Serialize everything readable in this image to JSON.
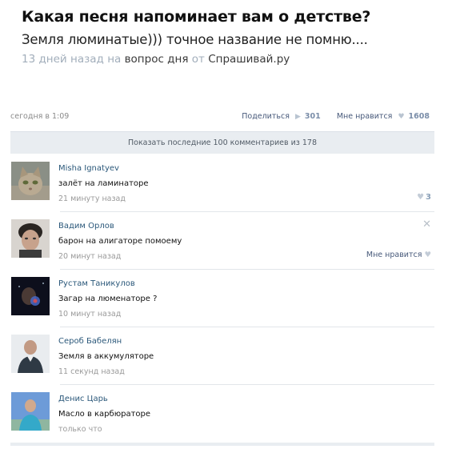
{
  "question": {
    "title": "Какая песня напоминает вам о детстве?",
    "body": "Земля люминатые))) точное название не помню....",
    "meta_time": "13 дней назад",
    "meta_on": "на",
    "meta_section": "вопрос дня",
    "meta_from": "от",
    "meta_source": "Спрашивай.ру"
  },
  "post_bar": {
    "date": "сегодня в 1:09",
    "share_label": "Поделиться",
    "share_count": "301",
    "like_label": "Мне нравится",
    "like_count": "1608"
  },
  "show_comments": "Показать последние 100 комментариев из 178",
  "comments": [
    {
      "author": "Misha Ignatyev",
      "text": "залёт на ламинаторе",
      "time": "21 минуту назад",
      "likes": "3"
    },
    {
      "author": "Вадим Орлов",
      "text": "барон на алигаторе помоему",
      "time": "20 минут назад",
      "like_label": "Мне нравится"
    },
    {
      "author": "Рустам Таникулов",
      "text": "Загар на люменаторе ?",
      "time": "10 минут назад"
    },
    {
      "author": "Сероб Бабелян",
      "text": "Земля в аккумуляторе",
      "time": "11 секунд назад"
    },
    {
      "author": "Денис Царь",
      "text": "Масло в карбюраторе",
      "time": "только что"
    }
  ],
  "icons": {
    "share": "megaphone-icon",
    "like": "heart-icon",
    "close": "close-icon"
  }
}
